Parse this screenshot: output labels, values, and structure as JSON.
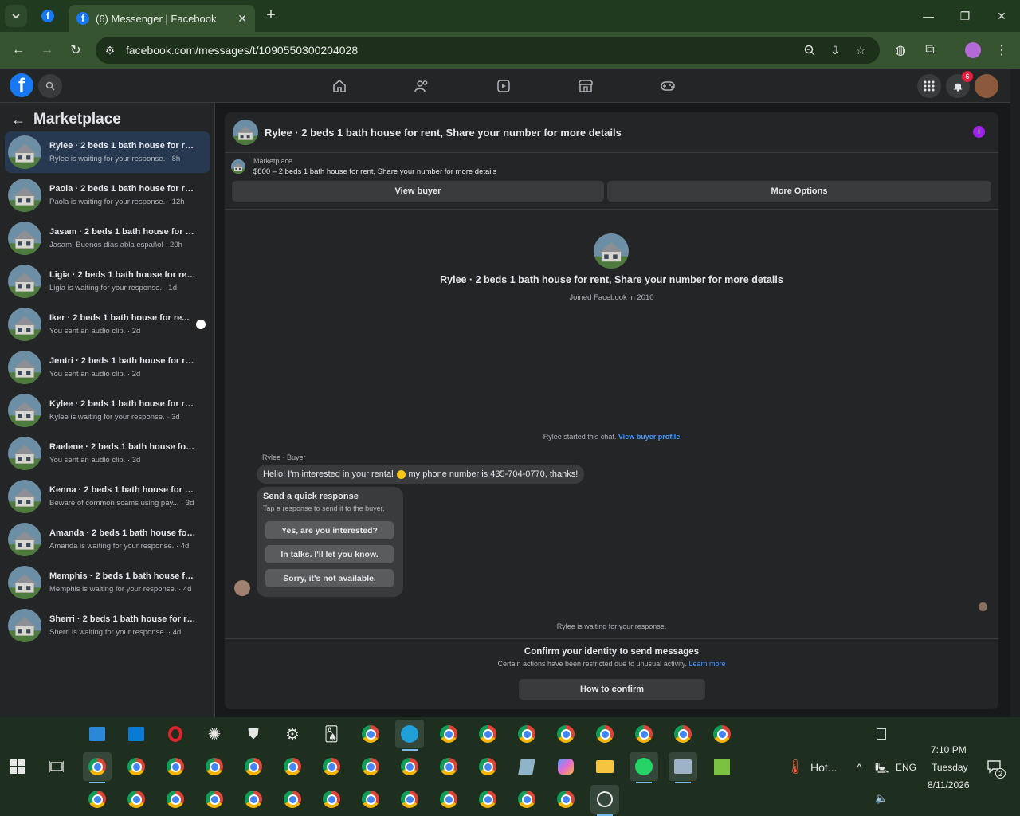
{
  "browser": {
    "tab_title": "(6) Messenger | Facebook",
    "url": "facebook.com/messages/t/1090550300204028"
  },
  "fb_header": {
    "notification_count": "6"
  },
  "sidebar": {
    "title": "Marketplace",
    "conversations": [
      {
        "name": "Rylee · 2 beds 1 bath house for ren...",
        "sub": "Rylee is waiting for your response. · 8h",
        "selected": true
      },
      {
        "name": "Paola · 2 beds 1 bath house for ren...",
        "sub": "Paola is waiting for your response. · 12h"
      },
      {
        "name": "Jasam · 2 beds 1 bath house for re...",
        "sub": "Jasam: Buenos días abla español · 20h"
      },
      {
        "name": "Ligia · 2 beds 1 bath house for rent...",
        "sub": "Ligia is waiting for your response. · 1d"
      },
      {
        "name": "Iker · 2 beds 1 bath house for re...",
        "sub": "You sent an audio clip. · 2d",
        "unread": true
      },
      {
        "name": "Jentri · 2 beds 1 bath house for ren...",
        "sub": "You sent an audio clip. · 2d"
      },
      {
        "name": "Kylee · 2 beds 1 bath house for ren...",
        "sub": "Kylee is waiting for your response. · 3d"
      },
      {
        "name": "Raelene · 2 beds 1 bath house for r...",
        "sub": "You sent an audio clip. · 3d"
      },
      {
        "name": "Kenna · 2 beds 1 bath house for re...",
        "sub": "Beware of common scams using pay... · 3d"
      },
      {
        "name": "Amanda · 2 beds 1 bath house for ...",
        "sub": "Amanda is waiting for your response. · 4d"
      },
      {
        "name": "Memphis · 2 beds 1 bath house for...",
        "sub": "Memphis is waiting for your response. · 4d"
      },
      {
        "name": "Sherri · 2 beds 1 bath house for re...",
        "sub": "Sherri is waiting for your response. · 4d"
      }
    ]
  },
  "chat": {
    "header_title": "Rylee · 2 beds 1 bath house for rent, Share your number for more details",
    "marketplace_label": "Marketplace",
    "listing": "$800 – 2 beds 1 bath house for rent, Share your number for more details",
    "view_buyer": "View buyer",
    "more_options": "More Options",
    "profile_name": "Rylee · 2 beds 1 bath house for rent, Share your number for more details",
    "joined": "Joined Facebook in 2010",
    "started_prefix": "Rylee started this chat.",
    "started_link": "View buyer profile",
    "sender": "Rylee · Buyer",
    "message_part1": "Hello! I'm interested in your rental",
    "message_part2": "my phone number is 435-704-0770, thanks!",
    "quick_title": "Send a quick response",
    "quick_sub": "Tap a response to send it to the buyer.",
    "quick_responses": [
      "Yes, are you interested?",
      "In talks. I'll let you know.",
      "Sorry, it's not available."
    ],
    "waiting": "Rylee is waiting for your response.",
    "confirm_title": "Confirm your identity to send messages",
    "confirm_sub": "Certain actions have been restricted due to unusual activity.",
    "learn_more": "Learn more",
    "how_to_confirm": "How to confirm"
  },
  "taskbar": {
    "weather": "Hot...",
    "lang": "ENG",
    "time": "7:10 PM",
    "day": "Tuesday",
    "date": "8/11/2026",
    "notif_count": "2"
  }
}
